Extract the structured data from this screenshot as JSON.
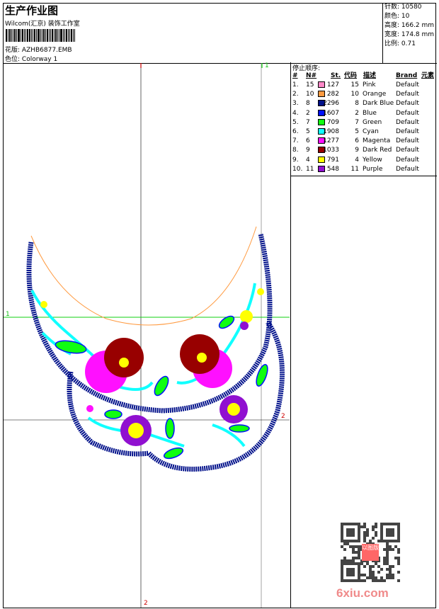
{
  "header": {
    "title": "生产作业图",
    "company": "Wilcom(汇京) 装饰工作室",
    "design_label": "花版:",
    "design_value": "AZHB6877.EMB",
    "colorway_label": "色位:",
    "colorway_value": "Colorway 1"
  },
  "info": {
    "stitches": "针数: 10580",
    "colors": "颜色: 10",
    "height": "高度: 166.2 mm",
    "width": "宽度: 174.8 mm",
    "scale": "比例: 0.71"
  },
  "table": {
    "title": "停止顺序:",
    "headers": {
      "num": "#",
      "n": "N#",
      "st": "St.",
      "code": "代码",
      "desc": "描述",
      "brand": "Brand",
      "element": "元素"
    },
    "rows": [
      {
        "num": "1.",
        "n": "15",
        "color": "#ff88c8",
        "st": "127",
        "code": "15",
        "desc": "Pink",
        "brand": "Default"
      },
      {
        "num": "2.",
        "n": "10",
        "color": "#ff9a40",
        "st": "282",
        "code": "10",
        "desc": "Orange",
        "brand": "Default"
      },
      {
        "num": "3.",
        "n": "8",
        "color": "#00108a",
        "st": "2296",
        "code": "8",
        "desc": "Dark Blue",
        "brand": "Default"
      },
      {
        "num": "4.",
        "n": "2",
        "color": "#0010ff",
        "st": "1607",
        "code": "2",
        "desc": "Blue",
        "brand": "Default"
      },
      {
        "num": "5.",
        "n": "7",
        "color": "#10ff10",
        "st": "709",
        "code": "7",
        "desc": "Green",
        "brand": "Default"
      },
      {
        "num": "6.",
        "n": "5",
        "color": "#10ffff",
        "st": "1908",
        "code": "5",
        "desc": "Cyan",
        "brand": "Default"
      },
      {
        "num": "7.",
        "n": "6",
        "color": "#ff10ff",
        "st": "1277",
        "code": "6",
        "desc": "Magenta",
        "brand": "Default"
      },
      {
        "num": "8.",
        "n": "9",
        "color": "#980000",
        "st": "1033",
        "code": "9",
        "desc": "Dark Red",
        "brand": "Default"
      },
      {
        "num": "9.",
        "n": "4",
        "color": "#ffff00",
        "st": "791",
        "code": "4",
        "desc": "Yellow",
        "brand": "Default"
      },
      {
        "num": "10.",
        "n": "11",
        "color": "#9010d0",
        "st": "548",
        "code": "11",
        "desc": "Purple",
        "brand": "Default"
      }
    ]
  },
  "guides": {
    "h1": "1",
    "v1": "1",
    "h2": "2",
    "v2": "2"
  },
  "watermark": {
    "site": "6xiu.com",
    "stamp": "以图版"
  }
}
